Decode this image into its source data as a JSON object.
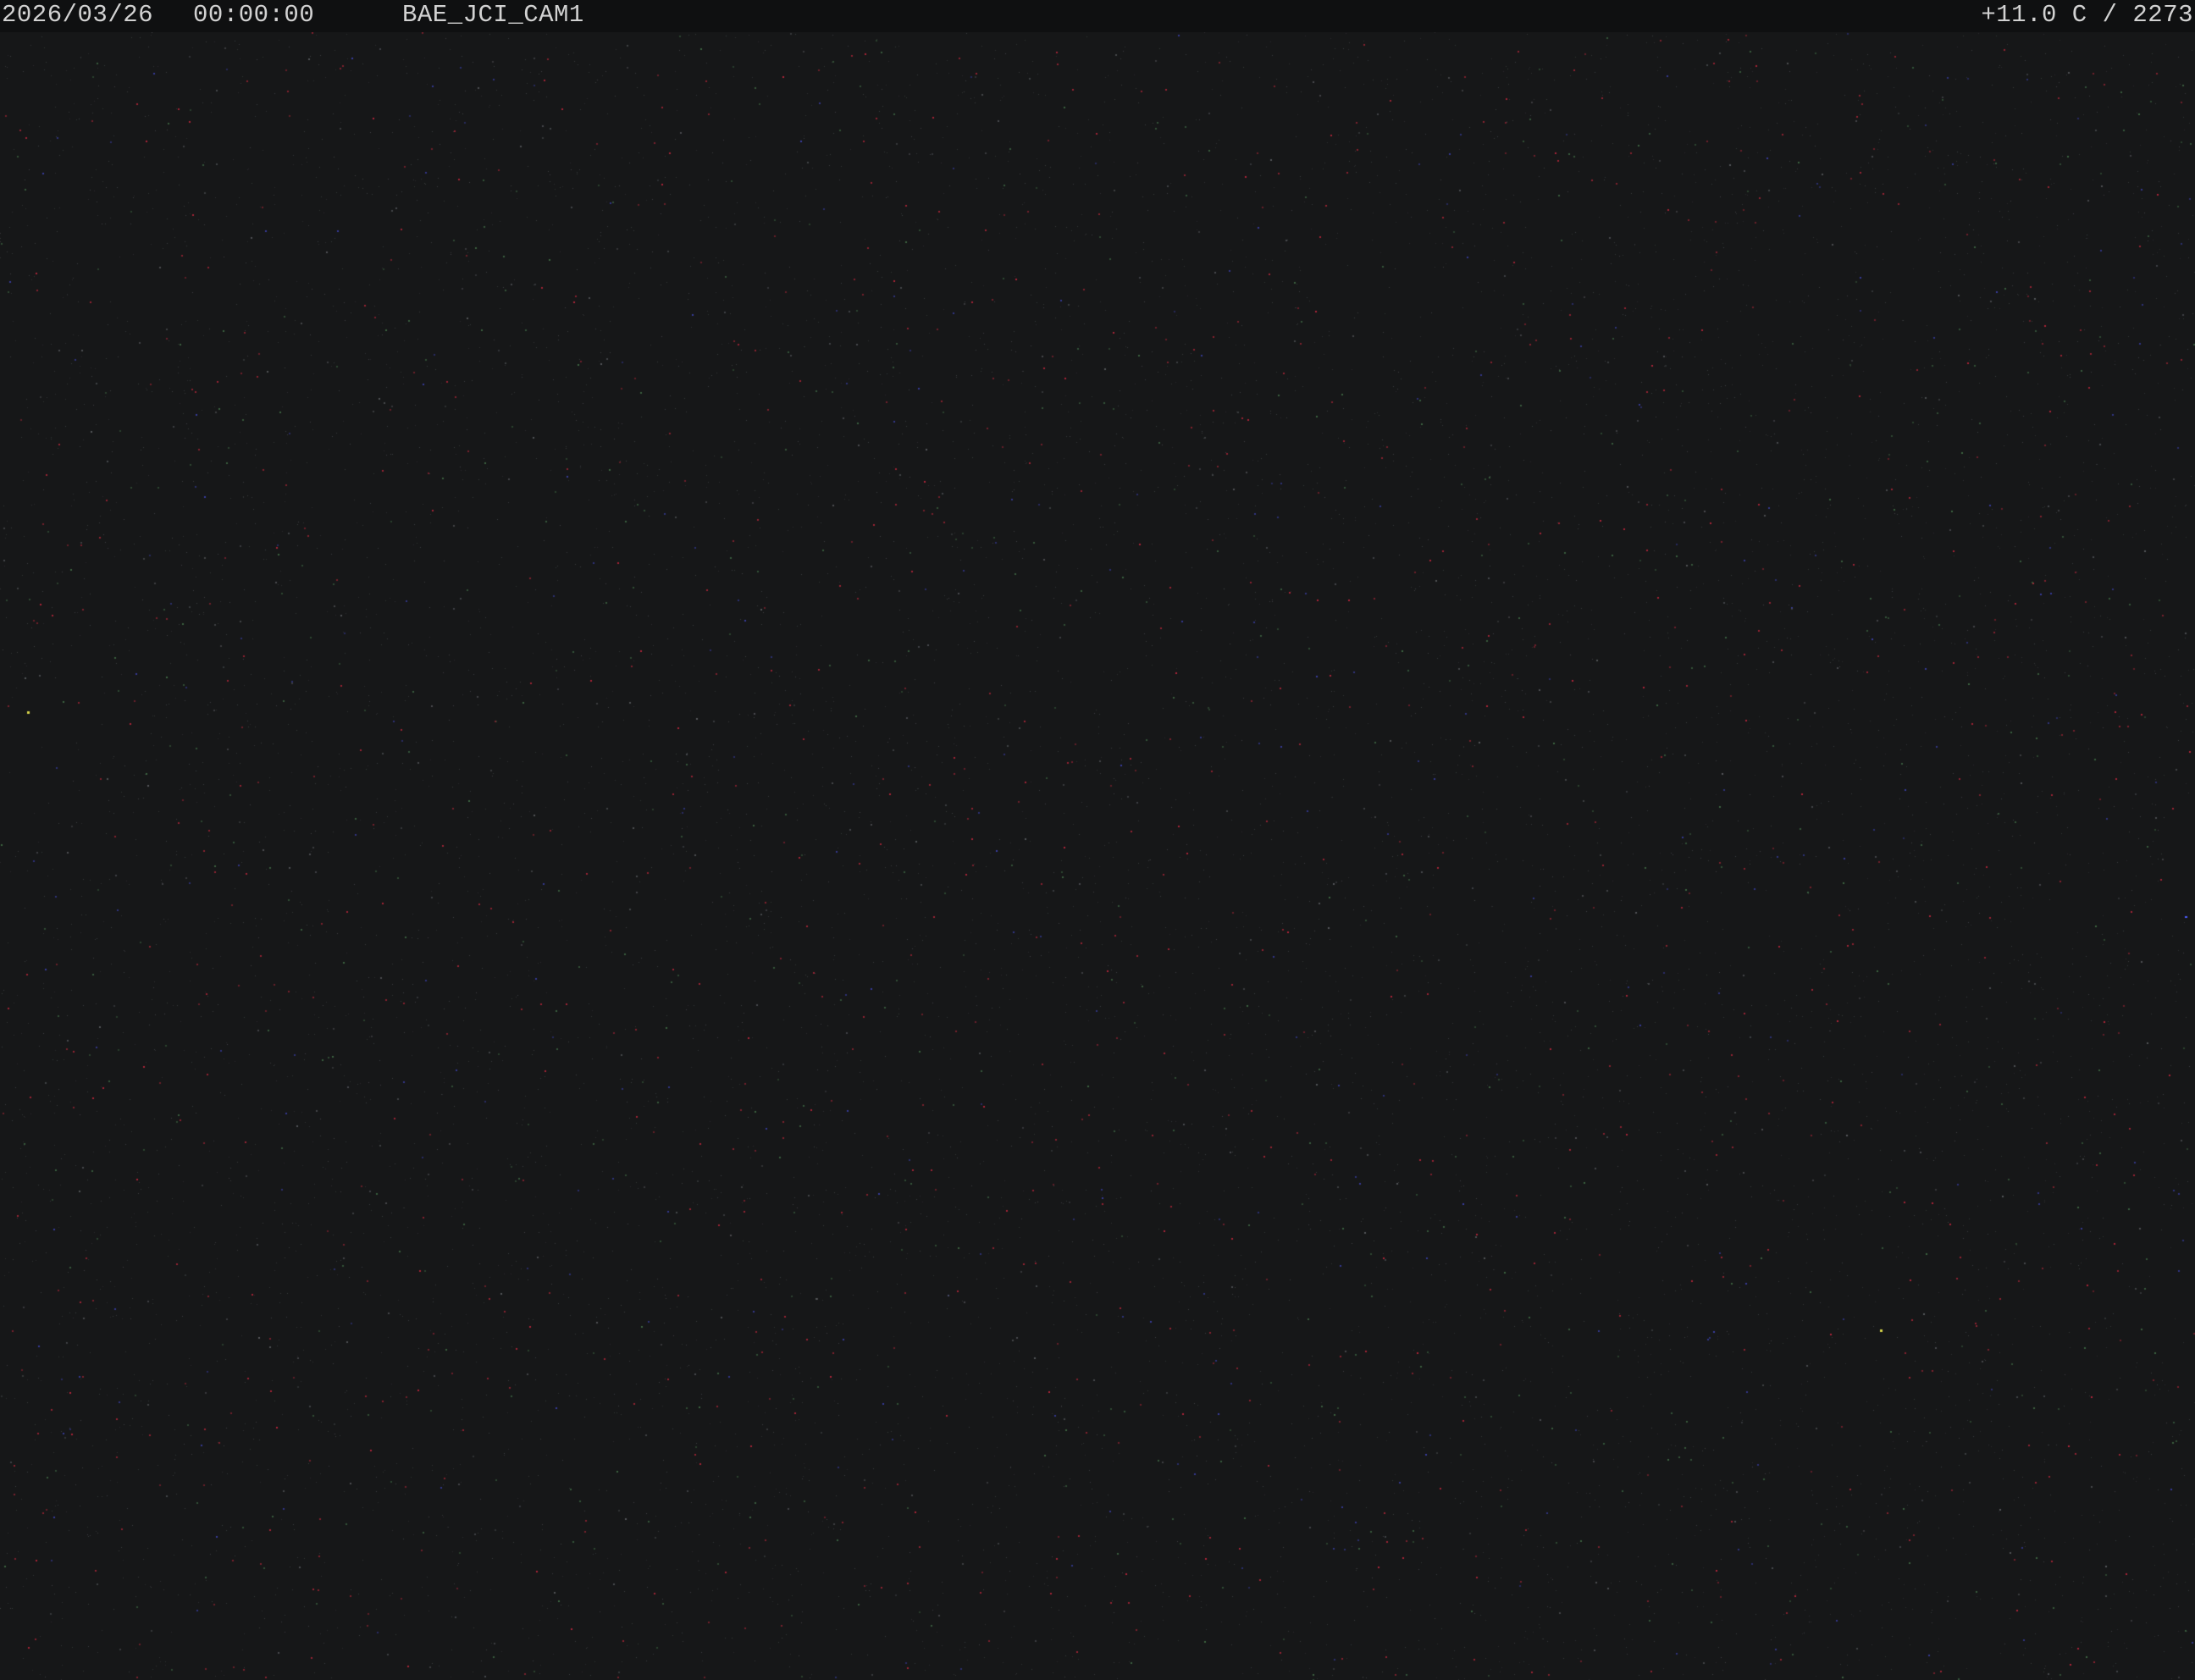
{
  "overlay": {
    "date": "2026/03/26",
    "time": "00:00:00",
    "camera_name": "BAE_JCI_CAM1",
    "temperature_readout": "+11.0 C / 2273"
  },
  "colors": {
    "sky_background": "#161718",
    "overlay_bar": "#0f1011",
    "overlay_text": "#d2d2d2",
    "noise_red": "#b8263a",
    "noise_green": "#3f6a44",
    "noise_blue": "#3a3fa8",
    "noise_yellow": "#d8d64a"
  }
}
